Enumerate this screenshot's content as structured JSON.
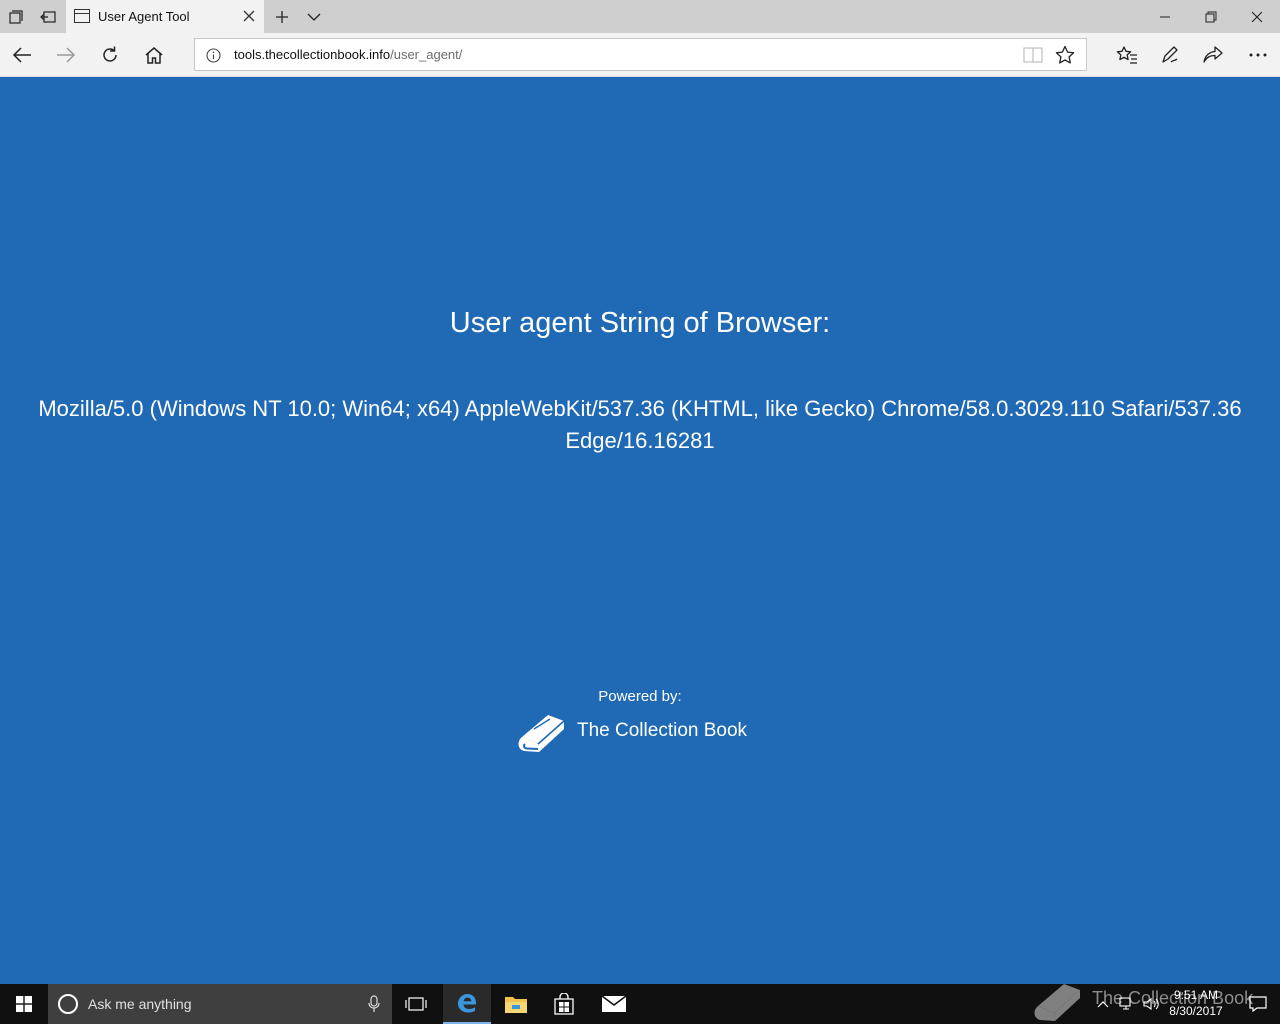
{
  "browser": {
    "tab_title": "User Agent Tool",
    "address": {
      "domain": "tools.thecollectionbook.info",
      "path": "/user_agent/"
    }
  },
  "page": {
    "heading": "User agent String of Browser:",
    "user_agent": "Mozilla/5.0 (Windows NT 10.0; Win64; x64) AppleWebKit/537.36 (KHTML, like Gecko) Chrome/58.0.3029.110 Safari/537.36 Edge/16.16281",
    "powered_by_label": "Powered by:",
    "brand_name": "The Collection Book"
  },
  "taskbar": {
    "search_placeholder": "Ask me anything",
    "clock_time": "9:51 AM",
    "clock_date": "8/30/2017",
    "watermark_text": "The Collection Book"
  },
  "icons": {
    "tab_manager": "tab-manager-icon",
    "set_aside": "set-aside-tabs-icon",
    "new_tab": "plus-icon",
    "tab_preview": "chevron-down-icon",
    "back": "back-arrow-icon",
    "forward": "forward-arrow-icon",
    "refresh": "refresh-icon",
    "home": "home-icon",
    "site_info": "info-icon",
    "reading_view": "reading-view-icon",
    "favorite": "star-icon",
    "hub": "favorites-hub-icon",
    "web_note": "pen-icon",
    "share": "share-icon",
    "more": "more-icon"
  },
  "colors": {
    "page_background": "#1f69b5",
    "chrome_background": "#f2f2f2",
    "titlebar_background": "#cfcfcf",
    "taskbar_background": "#101010",
    "taskbar_search_background": "#3f3f3f",
    "text_on_page": "#ffffff"
  }
}
